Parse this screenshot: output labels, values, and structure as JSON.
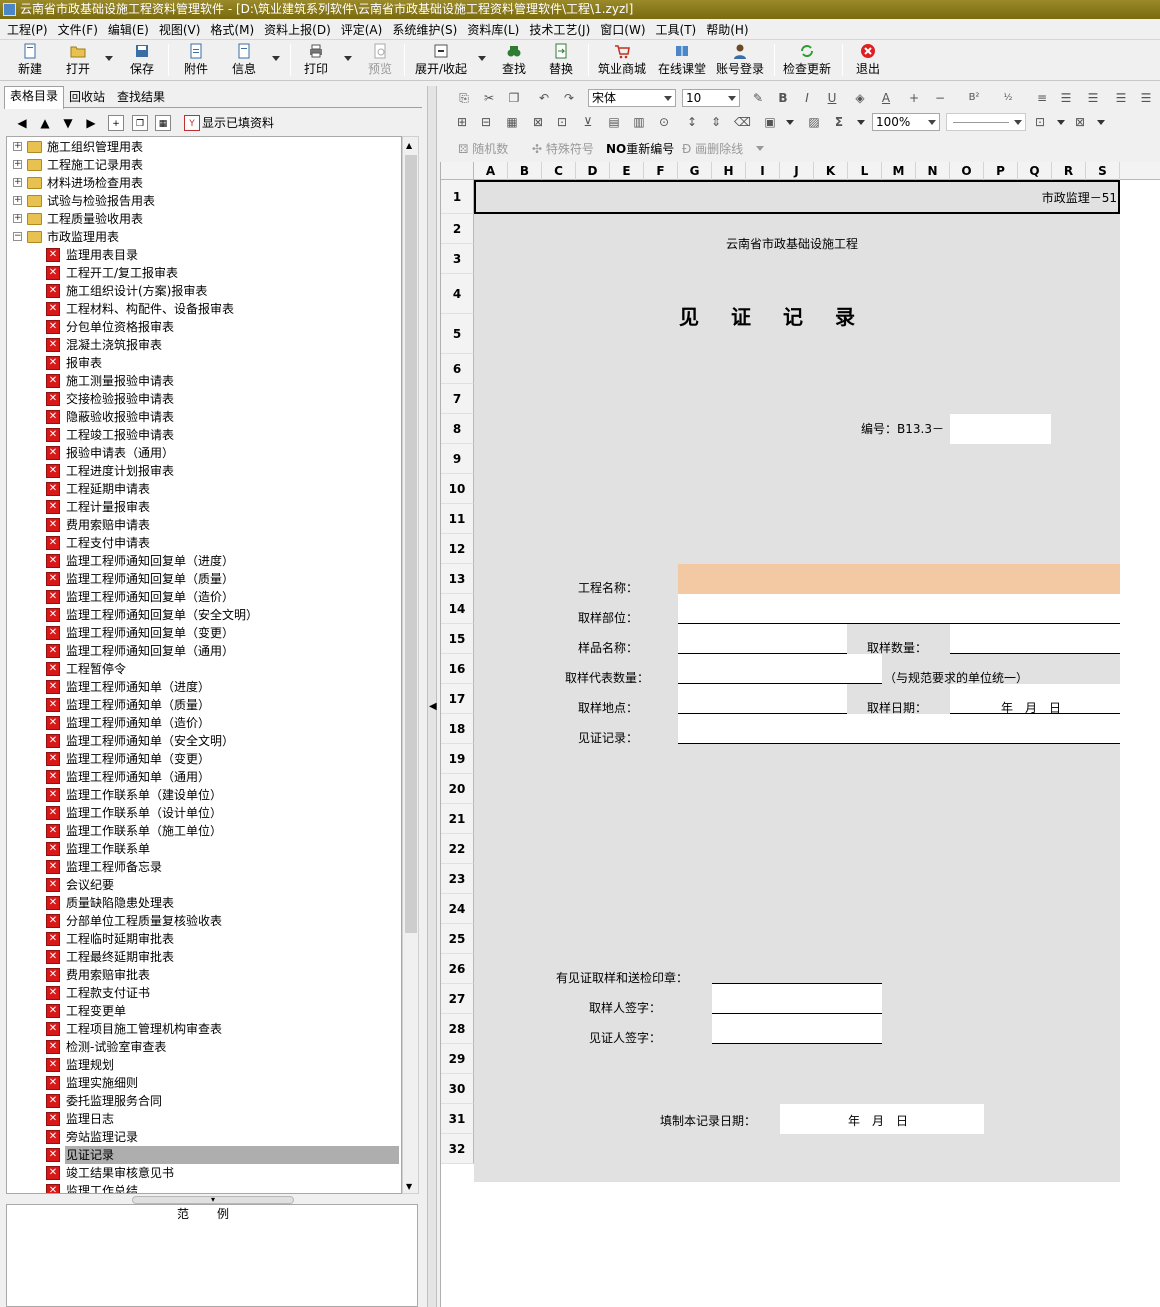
{
  "window": {
    "title": "云南省市政基础设施工程资料管理软件 - [D:\\筑业建筑系列软件\\云南省市政基础设施工程资料管理软件\\工程\\1.zyzl]"
  },
  "menu": [
    "工程(P)",
    "文件(F)",
    "编辑(E)",
    "视图(V)",
    "格式(M)",
    "资料上报(D)",
    "评定(A)",
    "系统维护(S)",
    "资料库(L)",
    "技术工艺(J)",
    "窗口(W)",
    "工具(T)",
    "帮助(H)"
  ],
  "toolbar": {
    "new": "新建",
    "open": "打开",
    "save": "保存",
    "attach": "附件",
    "info": "信息",
    "print": "打印",
    "preview": "预览",
    "expand": "展开/收起",
    "find": "查找",
    "replace": "替换",
    "mall": "筑业商城",
    "classroom": "在线课堂",
    "login": "账号登录",
    "update": "检查更新",
    "exit": "退出"
  },
  "left": {
    "tabs": [
      "表格目录",
      "回收站",
      "查找结果"
    ],
    "show_filled": "显示已填资料",
    "folders": [
      "施工组织管理用表",
      "工程施工记录用表",
      "材料进场检查用表",
      "试验与检验报告用表",
      "工程质量验收用表",
      "市政监理用表"
    ],
    "items": [
      "监理用表目录",
      "工程开工/复工报审表",
      "施工组织设计(方案)报审表",
      "工程材料、构配件、设备报审表",
      "分包单位资格报审表",
      "混凝土浇筑报审表",
      "报审表",
      "施工测量报验申请表",
      "交接检验报验申请表",
      "隐蔽验收报验申请表",
      "工程竣工报验申请表",
      "报验申请表（通用）",
      "工程进度计划报审表",
      "工程延期申请表",
      "工程计量报审表",
      "费用索赔申请表",
      "工程支付申请表",
      "监理工程师通知回复单（进度）",
      "监理工程师通知回复单（质量）",
      "监理工程师通知回复单（造价）",
      "监理工程师通知回复单（安全文明）",
      "监理工程师通知回复单（变更）",
      "监理工程师通知回复单（通用）",
      "工程暂停令",
      "监理工程师通知单（进度）",
      "监理工程师通知单（质量）",
      "监理工程师通知单（造价）",
      "监理工程师通知单（安全文明）",
      "监理工程师通知单（变更）",
      "监理工程师通知单（通用）",
      "监理工作联系单（建设单位）",
      "监理工作联系单（设计单位）",
      "监理工作联系单（施工单位）",
      "监理工作联系单",
      "监理工程师备忘录",
      "会议纪要",
      "质量缺陷隐患处理表",
      "分部单位工程质量复核验收表",
      "工程临时延期审批表",
      "工程最终延期审批表",
      "费用索赔审批表",
      "工程款支付证书",
      "工程变更单",
      "工程项目施工管理机构审查表",
      "检测-试验室审查表",
      "监理规划",
      "监理实施细则",
      "委托监理服务合同",
      "监理日志",
      "旁站监理记录",
      "见证记录",
      "竣工结果审核意见书",
      "监理工作总结"
    ],
    "legend": "范例"
  },
  "format": {
    "font": "宋体",
    "size": "10",
    "zoom": "100%",
    "random": "随机数",
    "special": "特殊符号",
    "renumber": "重新编号",
    "strike": "画删除线"
  },
  "sheet": {
    "columns": [
      "A",
      "B",
      "C",
      "D",
      "E",
      "F",
      "G",
      "H",
      "I",
      "J",
      "K",
      "L",
      "M",
      "N",
      "O",
      "P",
      "Q",
      "R",
      "S"
    ],
    "rows": [
      "1",
      "2",
      "3",
      "4",
      "5",
      "6",
      "7",
      "8",
      "9",
      "10",
      "11",
      "12",
      "13",
      "14",
      "15",
      "16",
      "17",
      "18",
      "19",
      "20",
      "21",
      "22",
      "23",
      "24",
      "25",
      "26",
      "27",
      "28",
      "29",
      "30",
      "31",
      "32"
    ],
    "code": "市政监理－51",
    "org": "云南省市政基础设施工程",
    "title": "见　证　记　录",
    "number_label": "编号：B13.3－",
    "project_name": "工程名称：",
    "sample_part": "取样部位：",
    "sample_name": "样品名称：",
    "sample_qty": "取样数量：",
    "rep_qty": "取样代表数量：",
    "unit_note": "（与规范要求的单位统一）",
    "location": "取样地点：",
    "sample_date": "取样日期：",
    "date_fill": "年　月　日",
    "witness_record": "见证记录：",
    "seal": "有见证取样和送检印章：",
    "sampler_sign": "取样人签字：",
    "witness_sign": "见证人签字：",
    "fill_date": "填制本记录日期：",
    "fill_date_value": "年　月　日"
  }
}
